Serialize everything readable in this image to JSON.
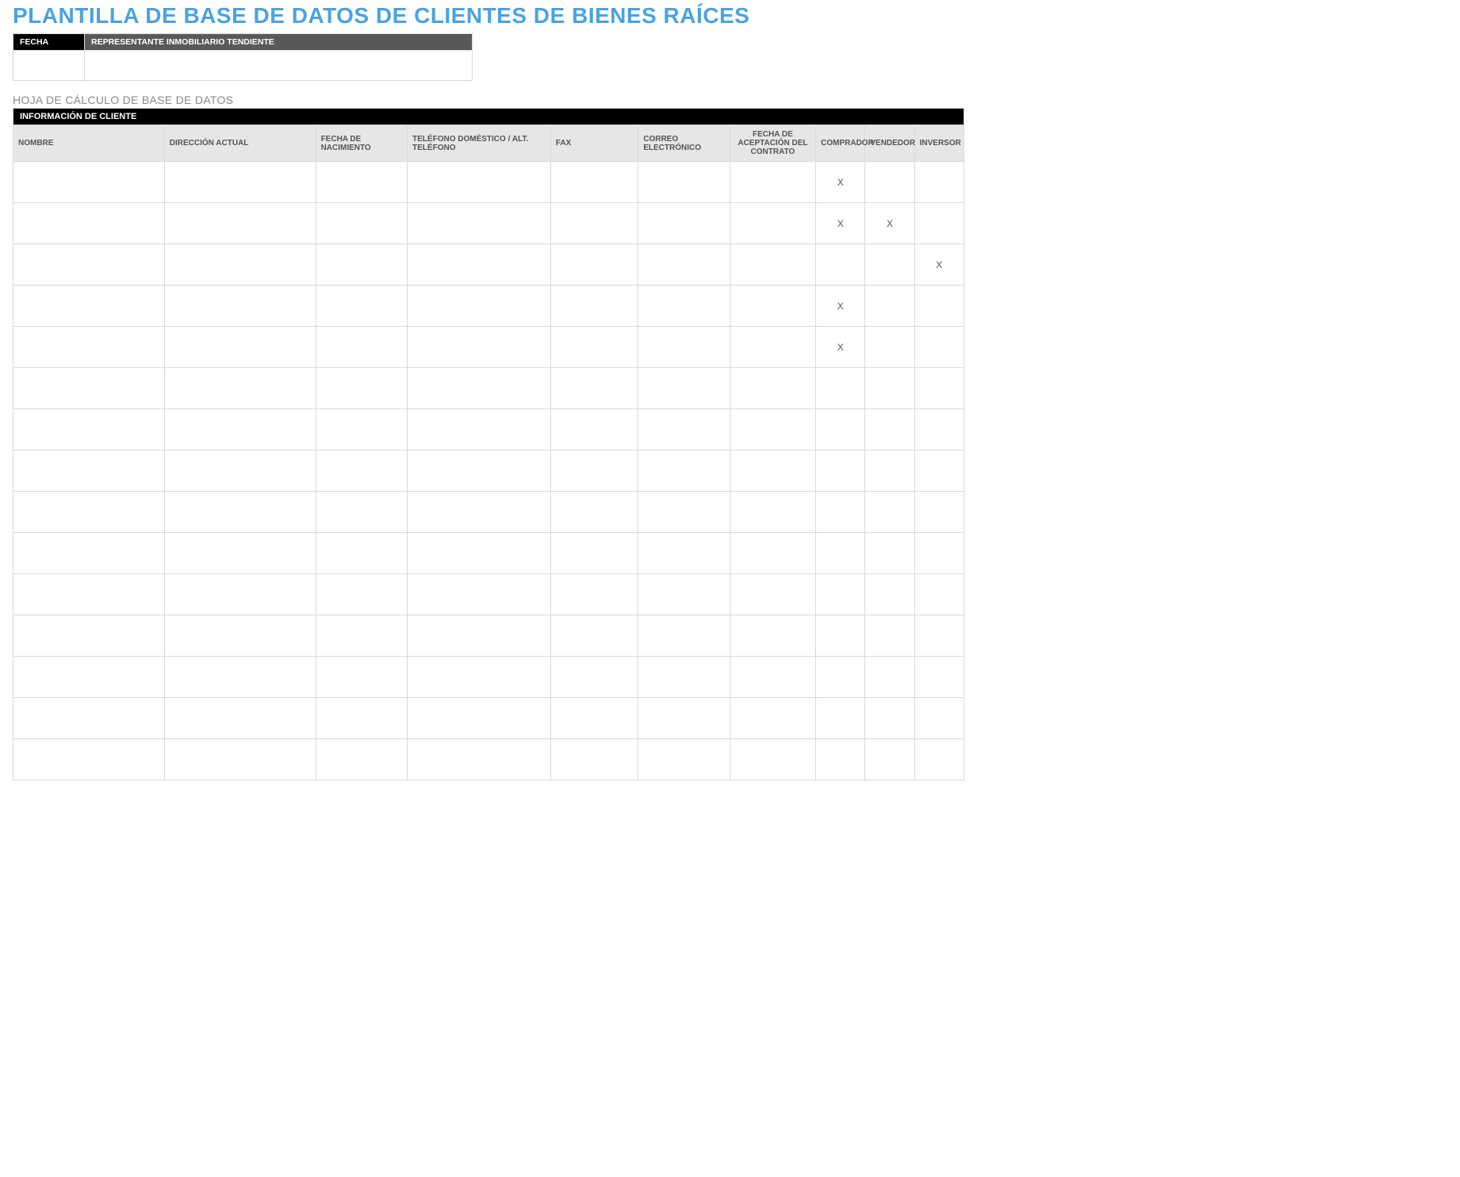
{
  "title": "PLANTILLA DE BASE DE DATOS DE CLIENTES DE BIENES RAÍCES",
  "meta": {
    "fecha_label": "FECHA",
    "rep_label": "REPRESENTANTE INMOBILIARIO TENDIENTE",
    "fecha_value": "",
    "rep_value": ""
  },
  "subtitle": "HOJA DE CÁLCULO DE BASE DE DATOS",
  "section_header": "INFORMACIÓN DE CLIENTE",
  "columns": {
    "nombre": "NOMBRE",
    "direccion": "DIRECCIÓN ACTUAL",
    "nacimiento": "FECHA DE NACIMIENTO",
    "telefono": "TELÉFONO DOMÉSTICO / ALT. TELÉFONO",
    "fax": "FAX",
    "email": "CORREO ELECTRÓNICO",
    "contrato": "FECHA DE ACEPTACIÓN DEL CONTRATO",
    "comprador": "COMPRADOR",
    "vendedor": "VENDEDOR",
    "inversor": "INVERSOR"
  },
  "rows": [
    {
      "nombre": "",
      "direccion": "",
      "nacimiento": "",
      "telefono": "",
      "fax": "",
      "email": "",
      "contrato": "",
      "comprador": "X",
      "vendedor": "",
      "inversor": ""
    },
    {
      "nombre": "",
      "direccion": "",
      "nacimiento": "",
      "telefono": "",
      "fax": "",
      "email": "",
      "contrato": "",
      "comprador": "X",
      "vendedor": "X",
      "inversor": ""
    },
    {
      "nombre": "",
      "direccion": "",
      "nacimiento": "",
      "telefono": "",
      "fax": "",
      "email": "",
      "contrato": "",
      "comprador": "",
      "vendedor": "",
      "inversor": "X"
    },
    {
      "nombre": "",
      "direccion": "",
      "nacimiento": "",
      "telefono": "",
      "fax": "",
      "email": "",
      "contrato": "",
      "comprador": "X",
      "vendedor": "",
      "inversor": ""
    },
    {
      "nombre": "",
      "direccion": "",
      "nacimiento": "",
      "telefono": "",
      "fax": "",
      "email": "",
      "contrato": "",
      "comprador": "X",
      "vendedor": "",
      "inversor": ""
    },
    {
      "nombre": "",
      "direccion": "",
      "nacimiento": "",
      "telefono": "",
      "fax": "",
      "email": "",
      "contrato": "",
      "comprador": "",
      "vendedor": "",
      "inversor": ""
    },
    {
      "nombre": "",
      "direccion": "",
      "nacimiento": "",
      "telefono": "",
      "fax": "",
      "email": "",
      "contrato": "",
      "comprador": "",
      "vendedor": "",
      "inversor": ""
    },
    {
      "nombre": "",
      "direccion": "",
      "nacimiento": "",
      "telefono": "",
      "fax": "",
      "email": "",
      "contrato": "",
      "comprador": "",
      "vendedor": "",
      "inversor": ""
    },
    {
      "nombre": "",
      "direccion": "",
      "nacimiento": "",
      "telefono": "",
      "fax": "",
      "email": "",
      "contrato": "",
      "comprador": "",
      "vendedor": "",
      "inversor": ""
    },
    {
      "nombre": "",
      "direccion": "",
      "nacimiento": "",
      "telefono": "",
      "fax": "",
      "email": "",
      "contrato": "",
      "comprador": "",
      "vendedor": "",
      "inversor": ""
    },
    {
      "nombre": "",
      "direccion": "",
      "nacimiento": "",
      "telefono": "",
      "fax": "",
      "email": "",
      "contrato": "",
      "comprador": "",
      "vendedor": "",
      "inversor": ""
    },
    {
      "nombre": "",
      "direccion": "",
      "nacimiento": "",
      "telefono": "",
      "fax": "",
      "email": "",
      "contrato": "",
      "comprador": "",
      "vendedor": "",
      "inversor": ""
    },
    {
      "nombre": "",
      "direccion": "",
      "nacimiento": "",
      "telefono": "",
      "fax": "",
      "email": "",
      "contrato": "",
      "comprador": "",
      "vendedor": "",
      "inversor": ""
    },
    {
      "nombre": "",
      "direccion": "",
      "nacimiento": "",
      "telefono": "",
      "fax": "",
      "email": "",
      "contrato": "",
      "comprador": "",
      "vendedor": "",
      "inversor": ""
    },
    {
      "nombre": "",
      "direccion": "",
      "nacimiento": "",
      "telefono": "",
      "fax": "",
      "email": "",
      "contrato": "",
      "comprador": "",
      "vendedor": "",
      "inversor": ""
    }
  ]
}
